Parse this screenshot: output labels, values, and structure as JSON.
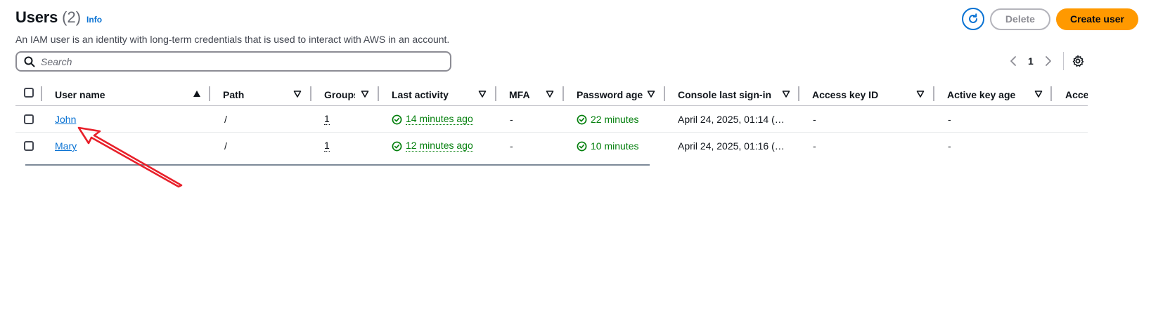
{
  "header": {
    "title": "Users",
    "count": "(2)",
    "info": "Info",
    "description": "An IAM user is an identity with long-term credentials that is used to interact with AWS in an account."
  },
  "actions": {
    "refresh_icon": "refresh-icon",
    "delete_label": "Delete",
    "create_label": "Create user"
  },
  "search": {
    "placeholder": "Search",
    "value": ""
  },
  "pagination": {
    "current_page": "1"
  },
  "table": {
    "columns": [
      {
        "label": "User name",
        "sort": "ascending"
      },
      {
        "label": "Path"
      },
      {
        "label": "Groups"
      },
      {
        "label": "Last activity"
      },
      {
        "label": "MFA"
      },
      {
        "label": "Password age"
      },
      {
        "label": "Console last sign-in"
      },
      {
        "label": "Access key ID"
      },
      {
        "label": "Active key age"
      },
      {
        "label": "Access"
      }
    ],
    "rows": [
      {
        "user_name": "John",
        "path": "/",
        "groups": "1",
        "last_activity": "14 minutes ago",
        "mfa": "-",
        "password_age": "22 minutes",
        "console_last_sign_in": "April 24, 2025, 01:14 (…",
        "access_key_id": "-",
        "active_key_age": "-"
      },
      {
        "user_name": "Mary",
        "path": "/",
        "groups": "1",
        "last_activity": "12 minutes ago",
        "mfa": "-",
        "password_age": "10 minutes",
        "console_last_sign_in": "April 24, 2025, 01:16 (…",
        "access_key_id": "-",
        "active_key_age": "-"
      }
    ]
  },
  "colors": {
    "link": "#0972d3",
    "primary_button": "#ff9900",
    "success": "#037f0c",
    "annotation_arrow": "#e8202a"
  }
}
